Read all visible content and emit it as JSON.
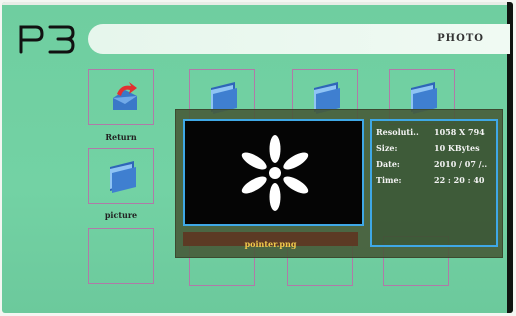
{
  "header": {
    "logo_text": "P3",
    "title": "PHOTO"
  },
  "items": [
    {
      "label": "Return",
      "icon": "return-arrow-icon"
    },
    {
      "label": "",
      "icon": "folder-icon"
    },
    {
      "label": "",
      "icon": "folder-icon"
    },
    {
      "label": "",
      "icon": "folder-icon"
    },
    {
      "label": "picture",
      "icon": "folder-icon"
    }
  ],
  "preview": {
    "filename": "pointer.png",
    "image": "asterisk-pointer"
  },
  "info": {
    "resolution_label": "Resoluti..",
    "resolution_value": "1058 X 794",
    "size_label": "Size:",
    "size_value": "10 KBytes",
    "date_label": "Date:",
    "date_value": "2010 / 07 /..",
    "time_label": "Time:",
    "time_value": "22 : 20 : 40"
  },
  "colors": {
    "background": "#6fcea0",
    "accent_border": "#3fa8e6",
    "tile_border": "#b07aa8",
    "filename_text": "#f2c94c"
  }
}
